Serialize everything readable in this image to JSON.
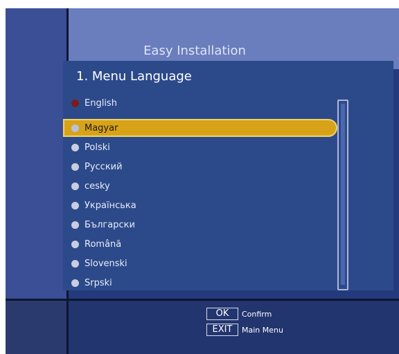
{
  "header": {
    "title": "Easy Installation"
  },
  "section": {
    "title": "1. Menu Language"
  },
  "languages": [
    {
      "label": "English",
      "state": "current"
    },
    {
      "label": "Magyar",
      "state": "selected"
    },
    {
      "label": "Polski",
      "state": "normal"
    },
    {
      "label": "Русский",
      "state": "normal"
    },
    {
      "label": "cesky",
      "state": "normal"
    },
    {
      "label": "Українська",
      "state": "normal"
    },
    {
      "label": "Български",
      "state": "normal"
    },
    {
      "label": "Română",
      "state": "normal"
    },
    {
      "label": "Slovenski",
      "state": "normal"
    },
    {
      "label": "Srpski",
      "state": "normal"
    }
  ],
  "footer": {
    "ok_key": "OK",
    "ok_label": "Confirm",
    "exit_key": "EXIT",
    "exit_label": "Main Menu"
  },
  "colors": {
    "background": "#233a7c",
    "header": "#6a7dbd",
    "highlight": "#d8a318",
    "current_dot": "#7a1c1c"
  }
}
